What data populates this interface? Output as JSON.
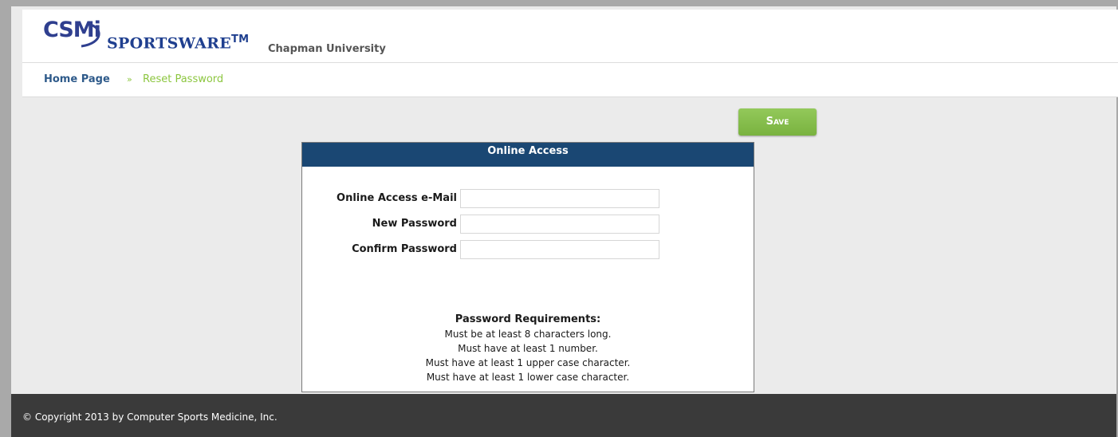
{
  "header": {
    "logo_text": "CSMi",
    "brand": "SPORTSWARE",
    "trademark": "TM",
    "organization": "Chapman University"
  },
  "breadcrumb": {
    "home": "Home Page",
    "separator": "»",
    "current": "Reset Password"
  },
  "toolbar": {
    "save_label": "Save"
  },
  "form": {
    "title": "Online Access",
    "fields": [
      {
        "label": "Online Access e-Mail",
        "value": ""
      },
      {
        "label": "New Password",
        "value": ""
      },
      {
        "label": "Confirm Password",
        "value": ""
      }
    ],
    "requirements_title": "Password Requirements:",
    "requirements": [
      "Must be at least 8 characters long.",
      "Must have at least 1 number.",
      "Must have at least 1 upper case character.",
      "Must have at least 1 lower case character."
    ]
  },
  "footer": {
    "copyright": "© Copyright 2013 by Computer Sports Medicine, Inc."
  },
  "colors": {
    "header_navy": "#1a4773",
    "accent_green": "#8cc63f",
    "footer_dark": "#3a3a3a",
    "brand_blue": "#1f3f8f"
  }
}
